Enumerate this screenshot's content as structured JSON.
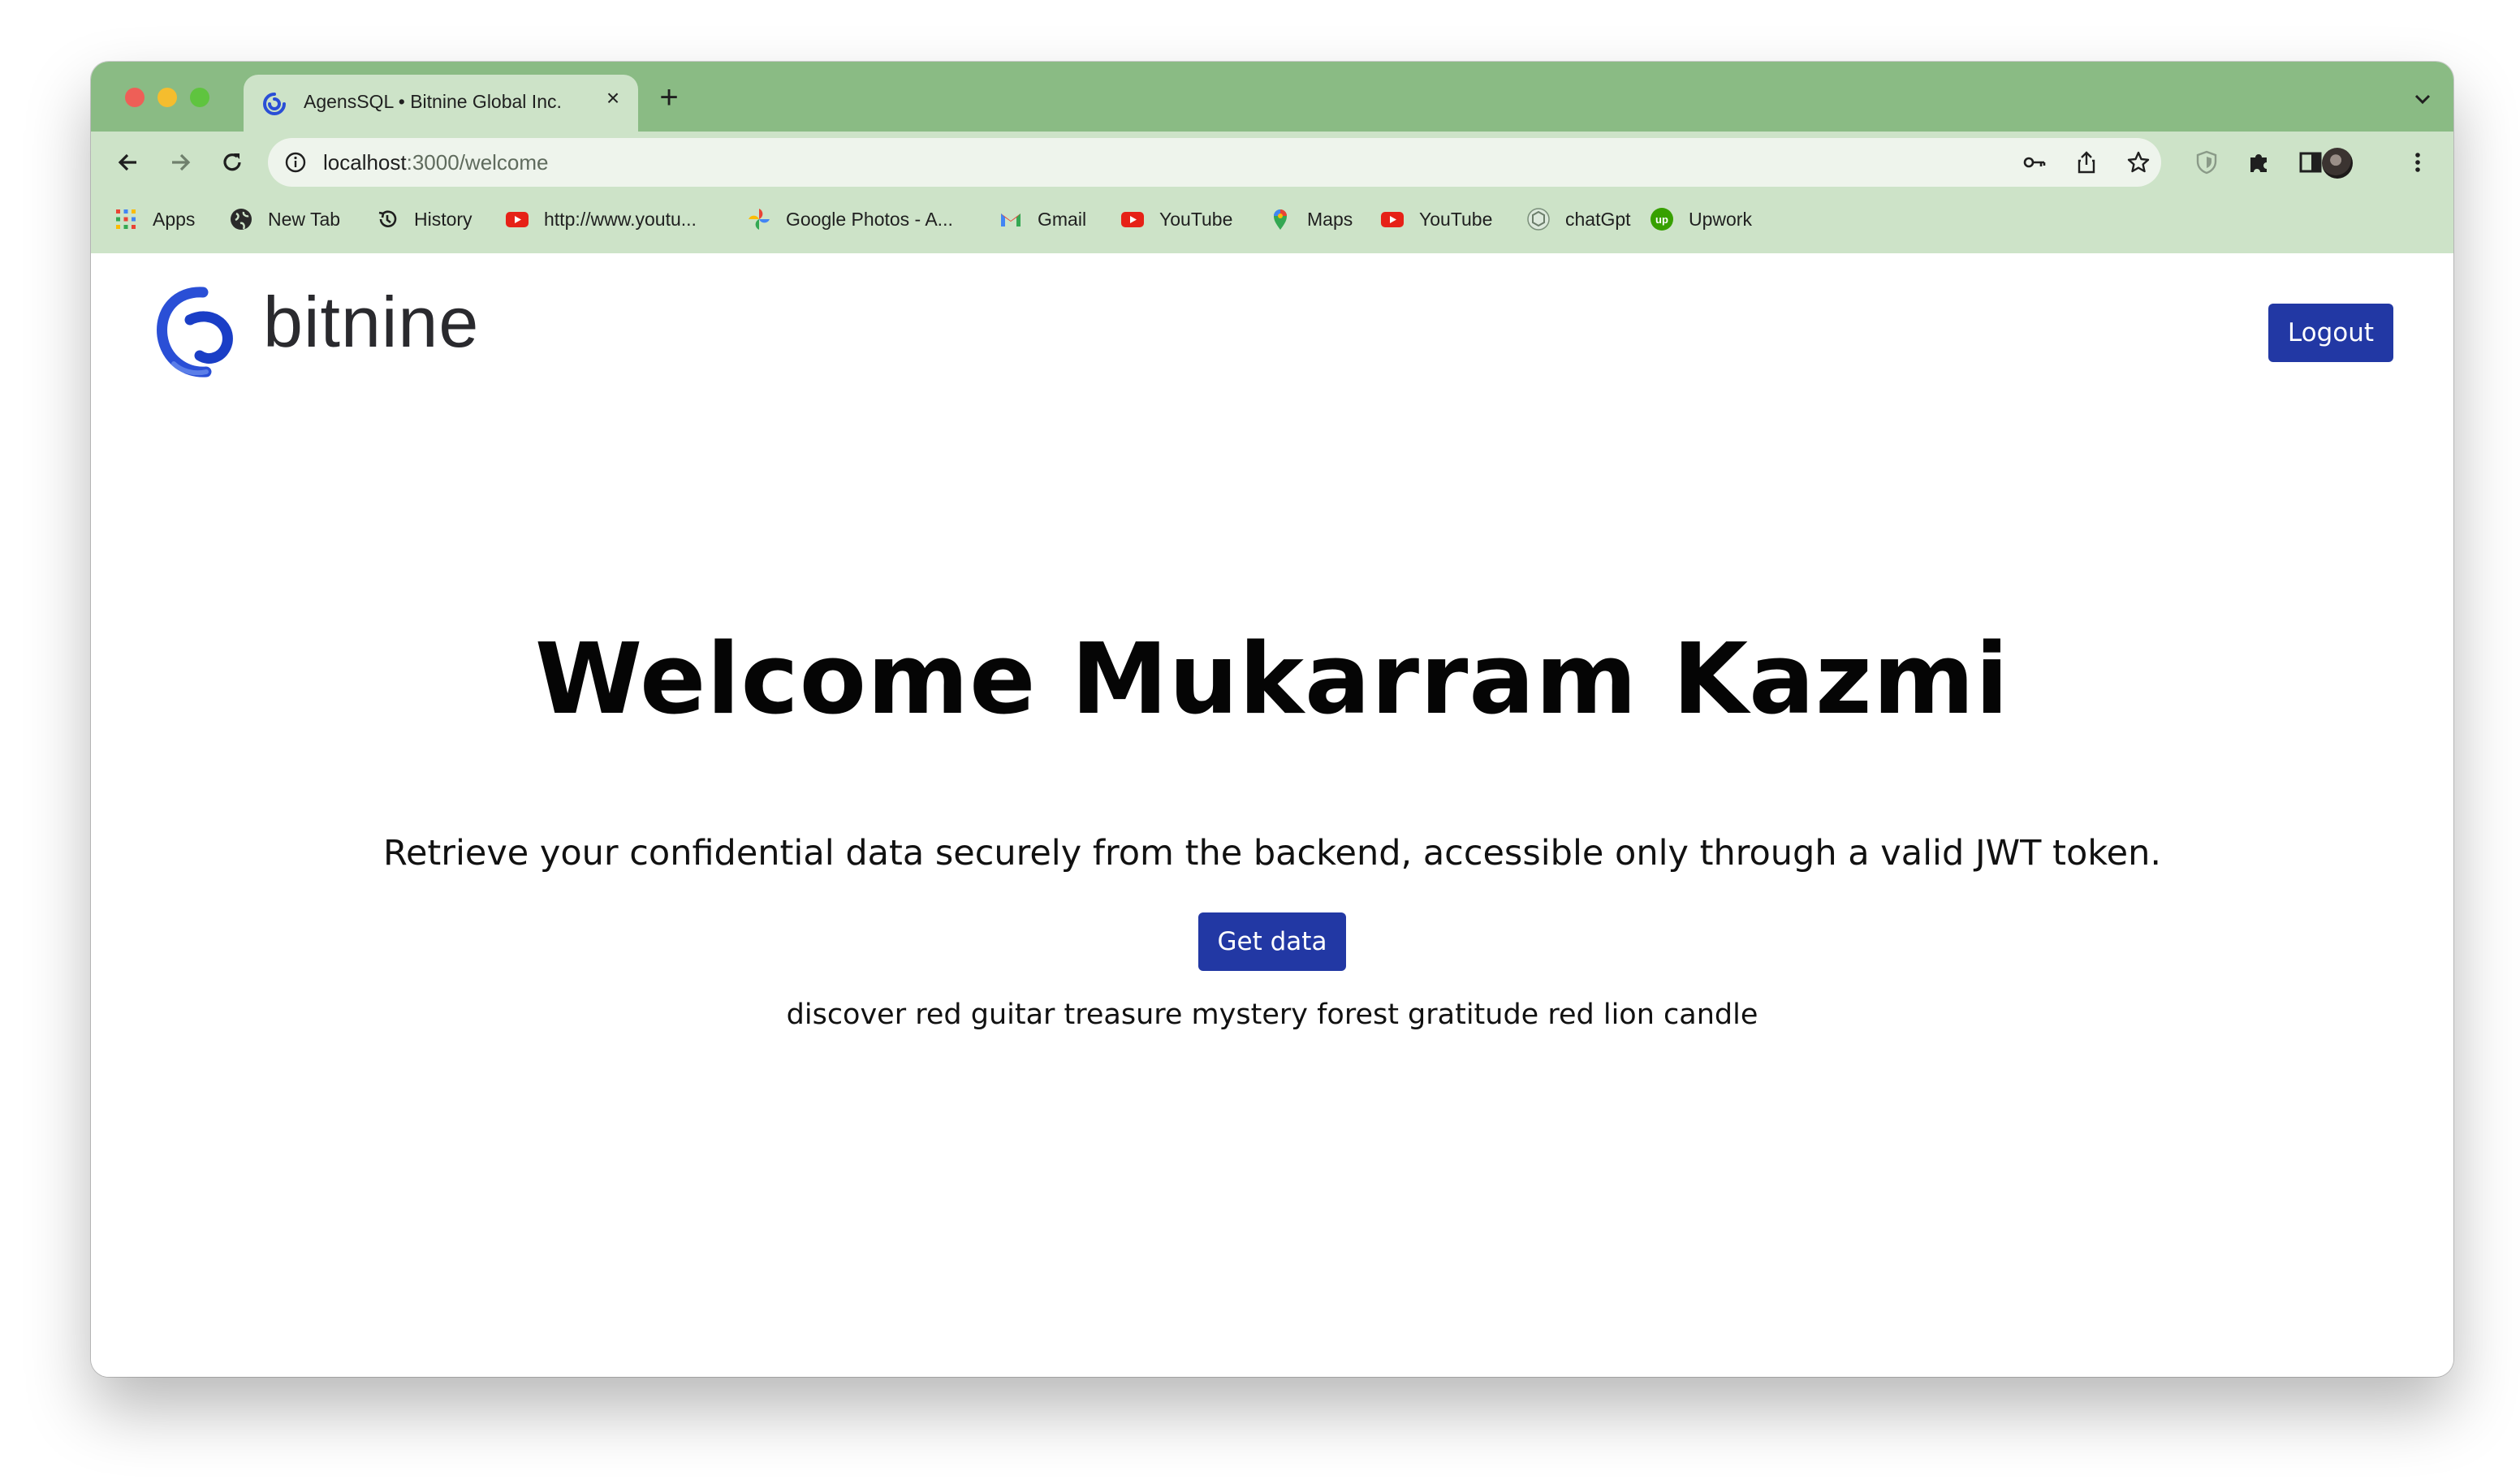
{
  "browser": {
    "tab": {
      "title": "AgensSQL • Bitnine Global Inc.",
      "close_label": "×"
    },
    "new_tab_label": "+",
    "url": {
      "host": "localhost",
      "path": ":3000/welcome"
    },
    "bookmarks": [
      {
        "label": "Apps",
        "icon": "apps-grid-icon"
      },
      {
        "label": "New Tab",
        "icon": "globe-icon"
      },
      {
        "label": "History",
        "icon": "history-icon"
      },
      {
        "label": "http://www.youtu...",
        "icon": "youtube-icon"
      },
      {
        "label": "Google Photos - A...",
        "icon": "google-photos-icon"
      },
      {
        "label": "Gmail",
        "icon": "gmail-icon"
      },
      {
        "label": "YouTube",
        "icon": "youtube-icon"
      },
      {
        "label": "Maps",
        "icon": "maps-pin-icon"
      },
      {
        "label": "YouTube",
        "icon": "youtube-icon"
      },
      {
        "label": "chatGpt",
        "icon": "chatgpt-icon"
      },
      {
        "label": "Upwork",
        "icon": "upwork-icon"
      }
    ],
    "colors": {
      "frame": "#8abb84",
      "toolbar": "#cde3c8"
    }
  },
  "site": {
    "logo_text": "bitnine",
    "logout_label": "Logout",
    "headline": "Welcome Mukarram Kazmi",
    "subline": "Retrieve your confidential data securely from the backend, accessible only through a valid JWT token.",
    "get_data_label": "Get data",
    "secret_text": "discover red guitar treasure mystery forest gratitude red lion candle",
    "colors": {
      "primary_button": "#2238a4"
    }
  }
}
